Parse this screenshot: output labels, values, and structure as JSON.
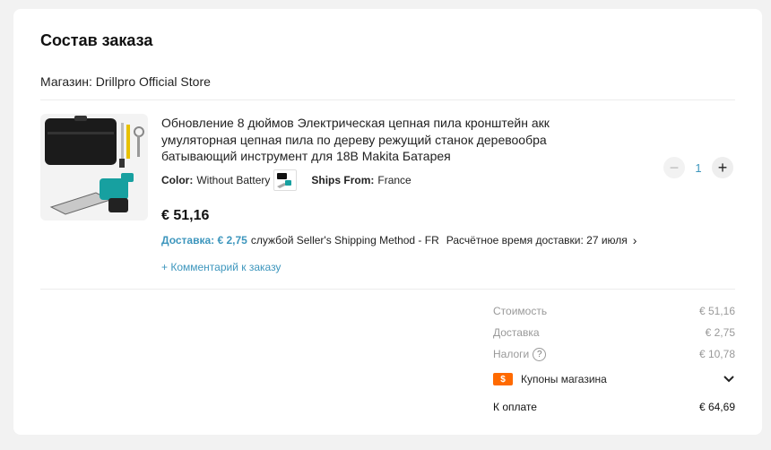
{
  "order": {
    "title": "Состав заказа",
    "store_label": "Магазин: Drillpro Official Store"
  },
  "product": {
    "name": "Обновление 8 дюймов Электрическая цепная пила кронштейн акк умуляторная цепная пила по дереву режущий станок деревообра батывающий инструмент для 18В Makita Батарея",
    "color_label": "Color:",
    "color_value": "Without Battery",
    "ships_label": "Ships From:",
    "ships_value": "France",
    "price": "€ 51,16",
    "delivery_link": "Доставка: € 2,75",
    "delivery_method": "службой Seller's Shipping Method - FR",
    "delivery_eta": "Расчётное время доставки: 27 июля",
    "comment_link": "+ Комментарий к заказу",
    "quantity": "1"
  },
  "summary": {
    "cost_label": "Стоимость",
    "cost_value": "€ 51,16",
    "delivery_label": "Доставка",
    "delivery_value": "€ 2,75",
    "taxes_label": "Налоги",
    "taxes_value": "€ 10,78",
    "coupons_label": "Купоны магазина",
    "total_label": "К оплате",
    "total_value": "€ 64,69"
  },
  "icons": {
    "coupon": "coupon-icon",
    "help": "question-circle-icon",
    "accent": "#3d96bd",
    "coupon_color": "#ff6a00"
  }
}
